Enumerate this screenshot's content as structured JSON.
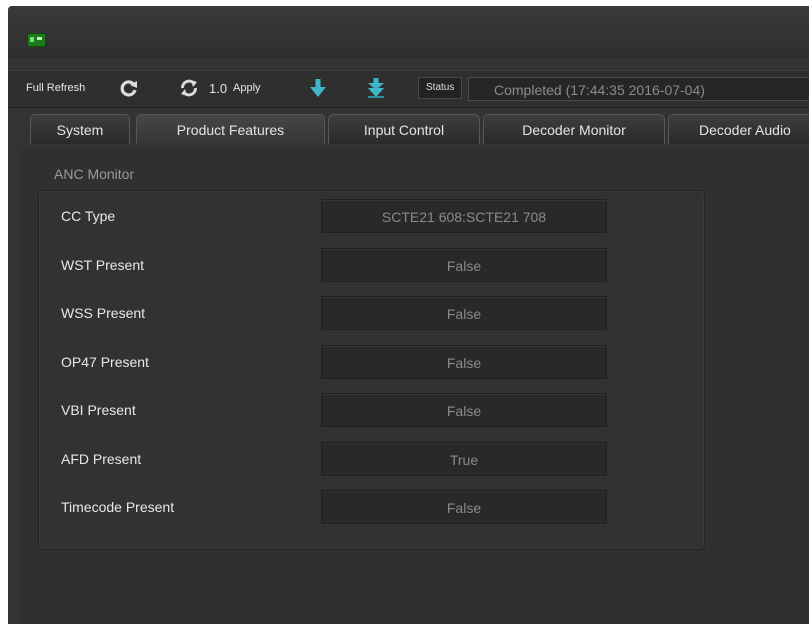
{
  "toolbar": {
    "full_refresh_label": "Full Refresh",
    "refresh_value": "1.0",
    "apply_label": "Apply",
    "status_label": "Status",
    "status_value": "Completed  (17:44:35  2016-07-04)"
  },
  "tabs": [
    {
      "label": "System"
    },
    {
      "label": "Product Features"
    },
    {
      "label": "Input Control"
    },
    {
      "label": "Decoder Monitor"
    },
    {
      "label": "Decoder Audio"
    }
  ],
  "section": {
    "title": "ANC Monitor",
    "rows": [
      {
        "label": "CC Type",
        "value": "SCTE21 608:SCTE21 708"
      },
      {
        "label": "WST Present",
        "value": "False"
      },
      {
        "label": "WSS Present",
        "value": "False"
      },
      {
        "label": "OP47 Present",
        "value": "False"
      },
      {
        "label": "VBI Present",
        "value": "False"
      },
      {
        "label": "AFD Present",
        "value": "True"
      },
      {
        "label": "Timecode Present",
        "value": "False"
      }
    ]
  },
  "icons": {
    "board": "circuit-board-icon",
    "refresh_one": "refresh-icon",
    "refresh_two": "auto-refresh-icon",
    "download_one": "download-arrow-icon",
    "download_two": "download-all-arrow-icon"
  },
  "colors": {
    "background": "#333333",
    "accent_teal": "#3fb7c9",
    "status_text": "#8b8b8b"
  }
}
